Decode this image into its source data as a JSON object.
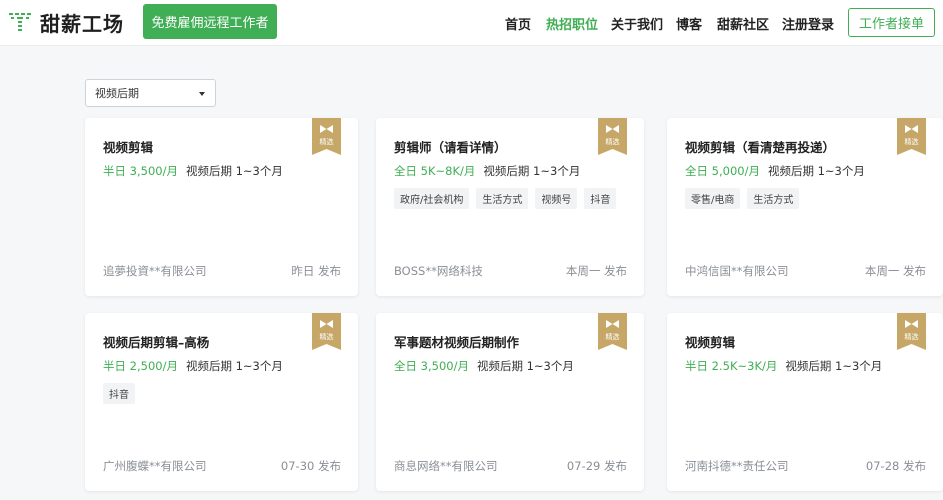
{
  "header": {
    "logo_text": "甜薪工场",
    "hire_button": "免费雇佣远程工作者",
    "nav": [
      "首页",
      "热招职位",
      "关于我们",
      "博客",
      "甜薪社区",
      "注册登录"
    ],
    "active_nav": "热招职位",
    "worker_button": "工作者接单"
  },
  "filter": {
    "value": "视频后期"
  },
  "colors": {
    "accent": "#3fae54",
    "badge": "#c6a767"
  },
  "jobs": [
    {
      "title": "视频剪辑",
      "salary": "半日 3,500/月",
      "category": "视频后期",
      "duration": "1~3个月",
      "tags": [],
      "company": "追夢投資**有限公司",
      "published": "昨日 发布",
      "badge": "精选"
    },
    {
      "title": "剪辑师（请看详情）",
      "salary": "全日 5K~8K/月",
      "category": "视频后期",
      "duration": "1~3个月",
      "tags": [
        "政府/社会机构",
        "生活方式",
        "视频号",
        "抖音"
      ],
      "company": "BOSS**网络科技",
      "published": "本周一 发布",
      "badge": "精选"
    },
    {
      "title": "视频剪辑（看清楚再投递）",
      "salary": "全日 5,000/月",
      "category": "视频后期",
      "duration": "1~3个月",
      "tags": [
        "零售/电商",
        "生活方式"
      ],
      "company": "中鸿信国**有限公司",
      "published": "本周一 发布",
      "badge": "精选"
    },
    {
      "title": "视频后期剪辑–高杨",
      "salary": "半日 2,500/月",
      "category": "视频后期",
      "duration": "1~3个月",
      "tags": [
        "抖音"
      ],
      "company": "广州腹蝶**有限公司",
      "published": "07-30 发布",
      "badge": "精选"
    },
    {
      "title": "军事题材视频后期制作",
      "salary": "全日 3,500/月",
      "category": "视频后期",
      "duration": "1~3个月",
      "tags": [],
      "company": "商息网络**有限公司",
      "published": "07-29 发布",
      "badge": "精选"
    },
    {
      "title": "视频剪辑",
      "salary": "半日 2.5K~3K/月",
      "category": "视频后期",
      "duration": "1~3个月",
      "tags": [],
      "company": "河南抖德**责任公司",
      "published": "07-28 发布",
      "badge": "精选"
    }
  ]
}
